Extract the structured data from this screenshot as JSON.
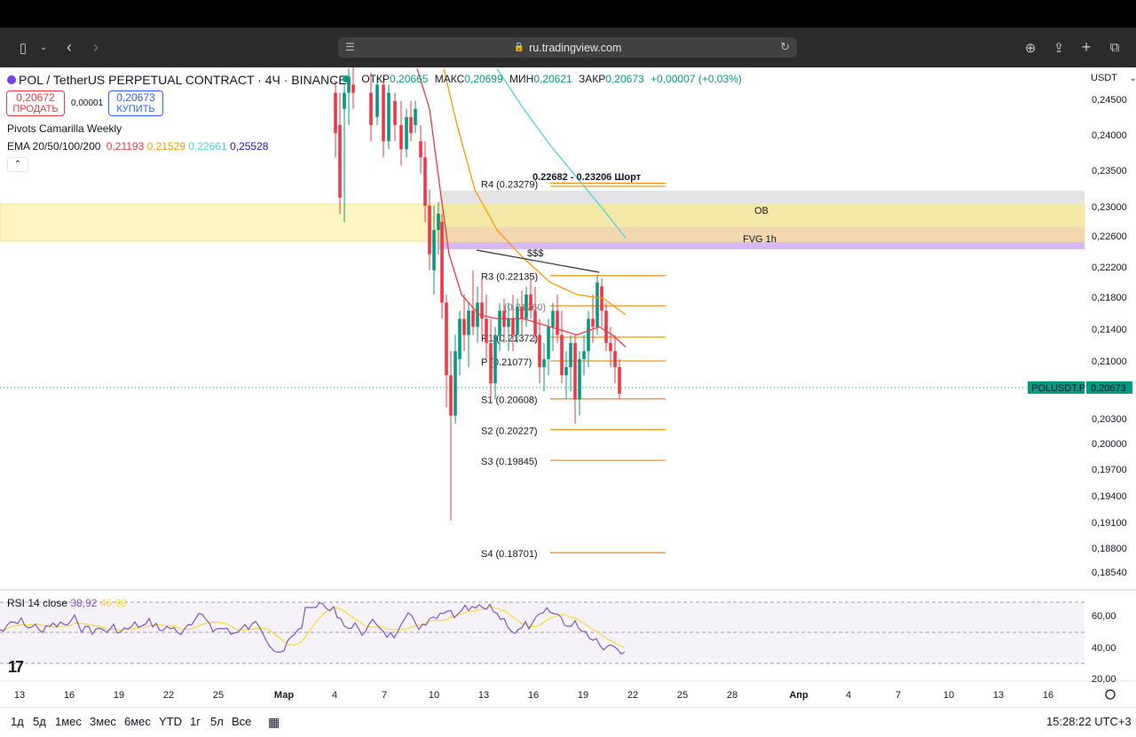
{
  "browser": {
    "url": "ru.tradingview.com"
  },
  "header": {
    "symbol": "POL / TetherUS PERPETUAL CONTRACT · 4Ч · BINANCE",
    "ohlc": [
      {
        "label": "ОТКР",
        "value": "0,20665"
      },
      {
        "label": "МАКС",
        "value": "0,20699"
      },
      {
        "label": "МИН",
        "value": "0,20621"
      },
      {
        "label": "ЗАКР",
        "value": "0,20673"
      }
    ],
    "change": "+0,00007 (+0,03%)",
    "currency": "USDT"
  },
  "trade": {
    "sell_price": "0,20672",
    "sell_label": "ПРОДАТЬ",
    "spread": "0,00001",
    "buy_price": "0,20673",
    "buy_label": "КУПИТЬ"
  },
  "indicators": {
    "pivots": "Pivots Camarilla Weekly",
    "ema_label": "EMA 20/50/100/200",
    "ema_values": [
      "0,21193",
      "0,21529",
      "0,22661",
      "0,25528"
    ],
    "ema_colors": [
      "#f23645",
      "#ff9800",
      "#4dd0e1",
      "#1a1ac6"
    ]
  },
  "annotations": {
    "zone_title": "0.22682 - 0.23206 Шорт",
    "ob": "OB",
    "fvg": "FVG 1h",
    "liquidity": "$$$"
  },
  "pivots": [
    {
      "name": "R4 (0.23279)",
      "value": 0.23279
    },
    {
      "name": "R3 (0.22135)",
      "value": 0.22135
    },
    {
      "name": "R2",
      "value": 0.2176
    },
    {
      "name": "R1 (0.21372)",
      "value": 0.21372
    },
    {
      "name": "P (0.21077)",
      "value": 0.21077
    },
    {
      "name": "S1 (0.20608)",
      "value": 0.20608
    },
    {
      "name": "S2 (0.20227)",
      "value": 0.20227
    },
    {
      "name": "S3 (0.19845)",
      "value": 0.19845
    },
    {
      "name": "S4 (0.18701)",
      "value": 0.18701
    }
  ],
  "pivot_partial": {
    "r2": "(0.21760)",
    "r1_prefix": "R1"
  },
  "price_axis": [
    "0,24500",
    "0,24000",
    "0,23500",
    "0,23000",
    "0,22600",
    "0,22200",
    "0,21800",
    "0,21400",
    "0,21000",
    "0,20300",
    "0,20000",
    "0,19700",
    "0,19400",
    "0,19100",
    "0,18800",
    "0,18540"
  ],
  "last_price": {
    "symbol": "POLUSDT.P",
    "value": "0,20673"
  },
  "rsi": {
    "label": "RSI 14 close",
    "value": "38,92",
    "ma": "46,98",
    "axis": [
      "60,00",
      "40,00",
      "20,00"
    ]
  },
  "time_axis": [
    "13",
    "16",
    "19",
    "22",
    "25",
    "Мар",
    "4",
    "7",
    "10",
    "13",
    "16",
    "19",
    "22",
    "25",
    "28",
    "Апр",
    "4",
    "7",
    "10",
    "13",
    "16"
  ],
  "timeframes": [
    "1д",
    "5д",
    "1мес",
    "3мес",
    "6мес",
    "YTD",
    "1г",
    "5л",
    "Все"
  ],
  "clock": "15:28:22 UTC+3",
  "colors": {
    "up": "#089981",
    "down": "#f23645",
    "pivot": "#f7931a",
    "rsi": "#7e57c2",
    "rsi_ma": "#fdd835"
  }
}
